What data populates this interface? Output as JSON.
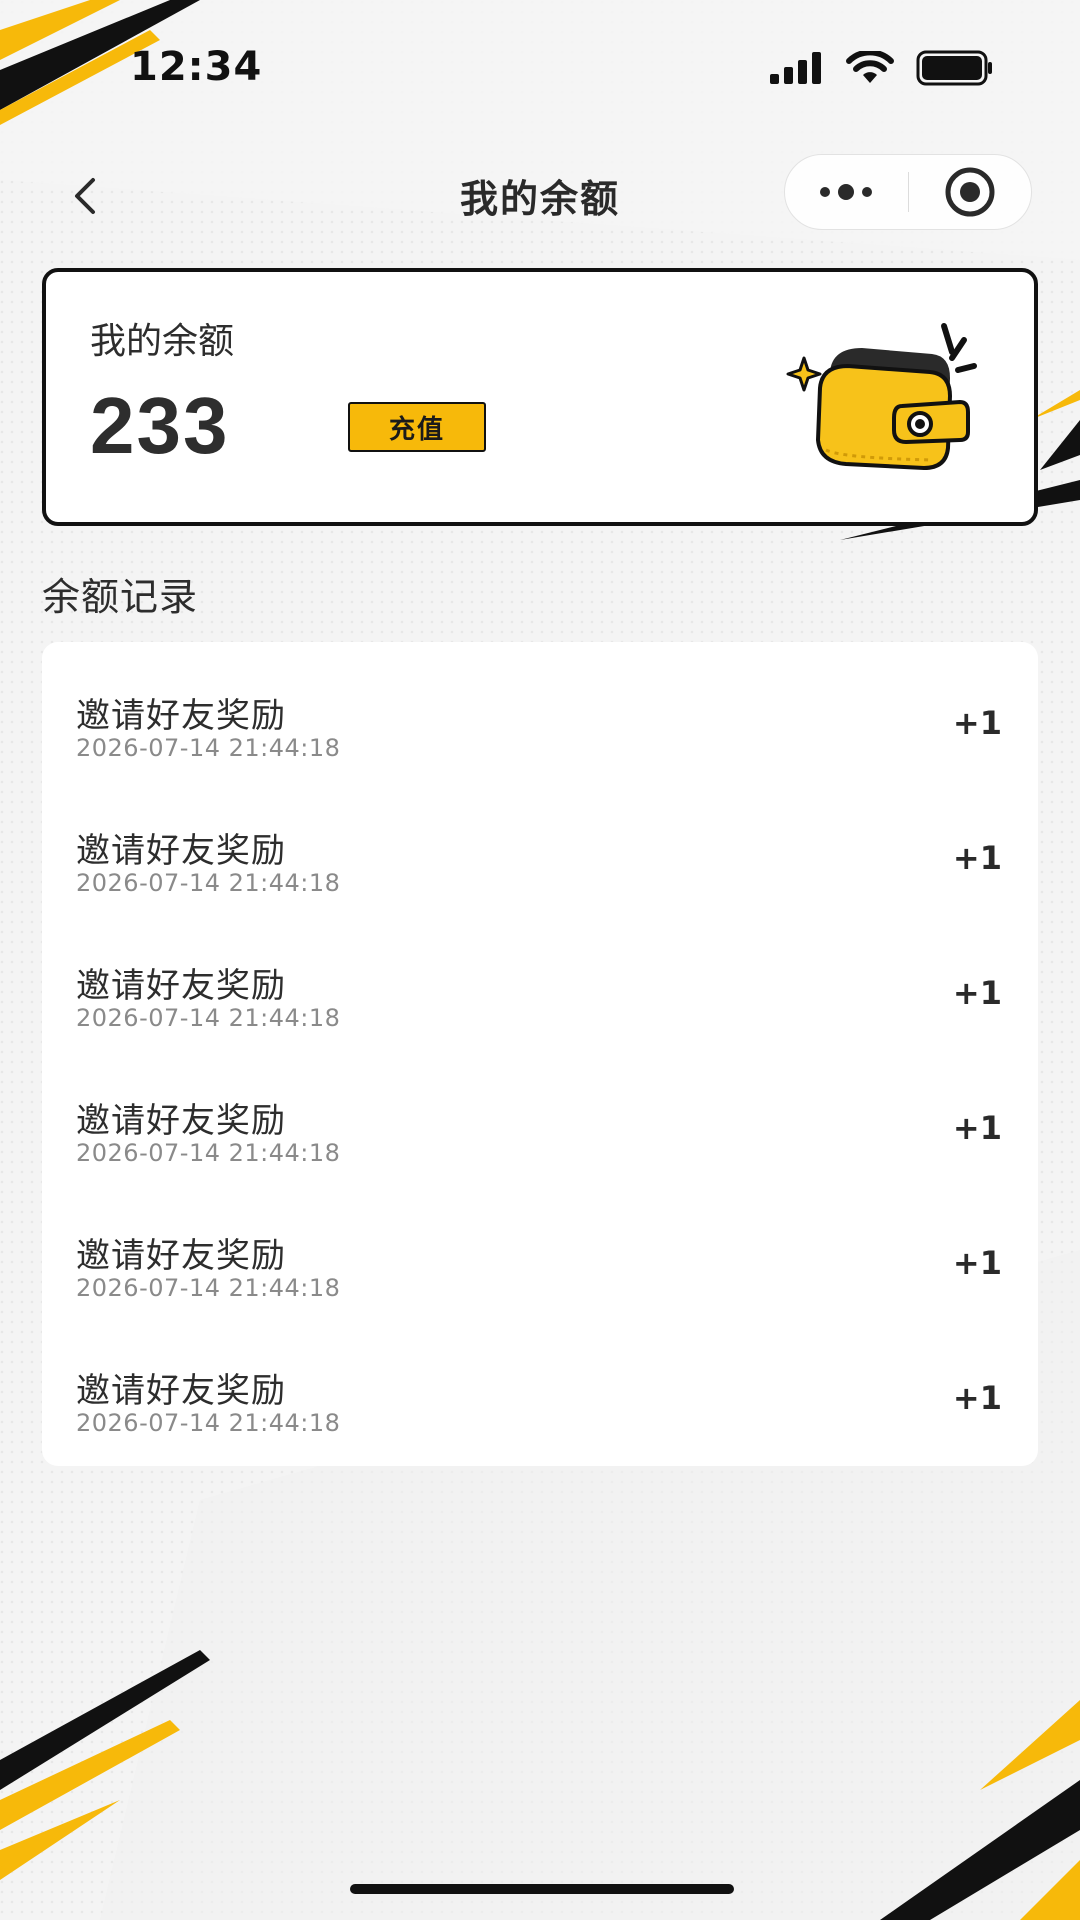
{
  "status_bar": {
    "time": "12:34"
  },
  "nav": {
    "title": "我的余额"
  },
  "balance_card": {
    "label": "我的余额",
    "value": "233",
    "recharge_label": "充值"
  },
  "records_section": {
    "title": "余额记录",
    "items": [
      {
        "title": "邀请好友奖励",
        "time": "2026-07-14 21:44:18",
        "amount": "+1"
      },
      {
        "title": "邀请好友奖励",
        "time": "2026-07-14 21:44:18",
        "amount": "+1"
      },
      {
        "title": "邀请好友奖励",
        "time": "2026-07-14 21:44:18",
        "amount": "+1"
      },
      {
        "title": "邀请好友奖励",
        "time": "2026-07-14 21:44:18",
        "amount": "+1"
      },
      {
        "title": "邀请好友奖励",
        "time": "2026-07-14 21:44:18",
        "amount": "+1"
      },
      {
        "title": "邀请好友奖励",
        "time": "2026-07-14 21:44:18",
        "amount": "+1"
      }
    ]
  },
  "icons": {
    "back": "chevron-left-icon",
    "more": "more-dots-icon",
    "close": "target-circle-icon",
    "signal": "signal-icon",
    "wifi": "wifi-icon",
    "battery": "battery-icon",
    "wallet": "wallet-icon"
  },
  "colors": {
    "accent": "#f7b90a",
    "text": "#2b2b2b",
    "muted": "#8a8a8a"
  }
}
